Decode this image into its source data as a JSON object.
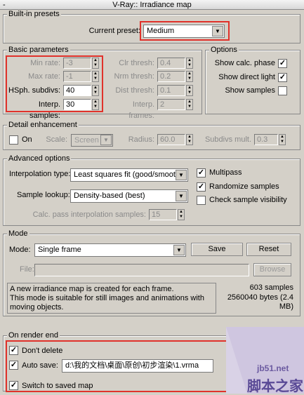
{
  "window": {
    "title": "V-Ray:: Irradiance map",
    "dash": "-"
  },
  "built_in_presets": {
    "title": "Built-in presets",
    "current_preset_label": "Current preset:",
    "current_preset_value": "Medium"
  },
  "basic_parameters": {
    "title": "Basic parameters",
    "min_rate": {
      "label": "Min rate:",
      "value": "-3"
    },
    "max_rate": {
      "label": "Max rate:",
      "value": "-1"
    },
    "hsph_subdivs": {
      "label": "HSph. subdivs:",
      "value": "40"
    },
    "interp_samples": {
      "label": "Interp. samples:",
      "value": "30"
    },
    "clr_thresh": {
      "label": "Clr thresh:",
      "value": "0.4"
    },
    "nrm_thresh": {
      "label": "Nrm thresh:",
      "value": "0.2"
    },
    "dist_thresh": {
      "label": "Dist thresh:",
      "value": "0.1"
    },
    "interp_frames": {
      "label": "Interp. frames:",
      "value": "2"
    }
  },
  "options": {
    "title": "Options",
    "show_calc_phase": {
      "label": "Show calc. phase",
      "checked": "✓"
    },
    "show_direct_light": {
      "label": "Show direct light",
      "checked": "✓"
    },
    "show_samples": {
      "label": "Show samples",
      "checked": ""
    }
  },
  "detail_enhancement": {
    "title": "Detail enhancement",
    "on_label": "On",
    "scale_label": "Scale:",
    "scale_value": "Screen",
    "radius_label": "Radius:",
    "radius_value": "60.0",
    "subdivs_mult_label": "Subdivs mult.",
    "subdivs_mult_value": "0.3"
  },
  "advanced_options": {
    "title": "Advanced options",
    "interpolation_type_label": "Interpolation type:",
    "interpolation_type_value": "Least squares fit (good/smooth",
    "sample_lookup_label": "Sample lookup:",
    "sample_lookup_value": "Density-based (best)",
    "calc_pass_label": "Calc. pass interpolation samples:",
    "calc_pass_value": "15",
    "multipass": {
      "label": "Multipass",
      "checked": "✓"
    },
    "randomize_samples": {
      "label": "Randomize samples",
      "checked": "✓"
    },
    "check_sample_visibility": {
      "label": "Check sample visibility",
      "checked": ""
    }
  },
  "mode": {
    "title": "Mode",
    "mode_label": "Mode:",
    "mode_value": "Single frame",
    "save_label": "Save",
    "reset_label": "Reset",
    "file_label": "File:",
    "file_value": "",
    "browse_label": "Browse",
    "description_lines": [
      "A new irradiance map is created for each frame.",
      "This mode is suitable for still images and animations with",
      "moving objects."
    ],
    "samples": "603 samples",
    "bytes_line1": "2560040 bytes (2.4",
    "bytes_line2": "MB)"
  },
  "on_render_end": {
    "title": "On render end",
    "dont_delete": {
      "label": "Don't delete",
      "checked": "✓"
    },
    "auto_save": {
      "label": "Auto save:",
      "checked": "✓",
      "path": "d:\\我的文档\\桌面\\原创\\初步渲染\\1.vrma"
    },
    "switch_to_saved_map": {
      "label": "Switch to saved map",
      "checked": "✓"
    }
  },
  "watermark": {
    "site": "jb51.net",
    "brand": "脚本之家"
  },
  "icons": {
    "dropdown": "▼",
    "spin_up": "▲",
    "spin_down": "▼"
  }
}
